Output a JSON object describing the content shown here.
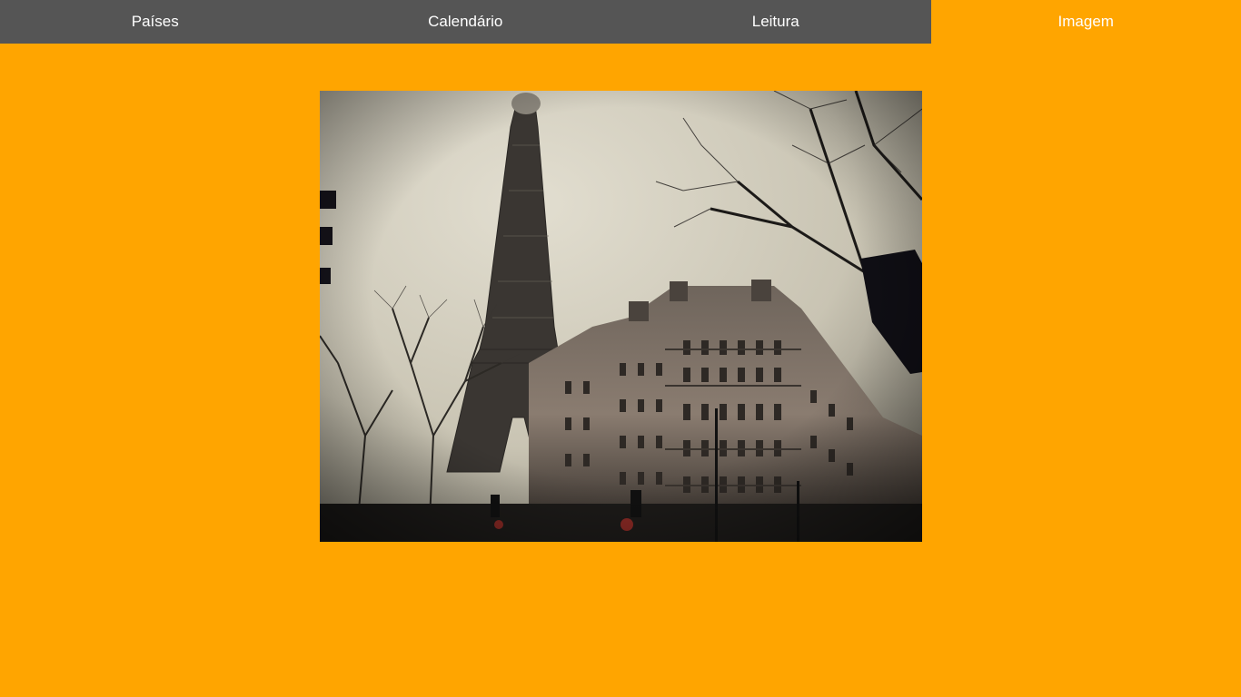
{
  "nav": {
    "items": [
      {
        "label": "Países",
        "active": false
      },
      {
        "label": "Calendário",
        "active": false
      },
      {
        "label": "Leitura",
        "active": false
      },
      {
        "label": "Imagem",
        "active": true
      }
    ]
  },
  "colors": {
    "page_background": "#FFA500",
    "nav_background": "#555555",
    "nav_text": "#FFFFFF",
    "nav_active_background": "#FFA500"
  },
  "main": {
    "image": {
      "subject": "eiffel-tower-paris-street-photo"
    }
  }
}
